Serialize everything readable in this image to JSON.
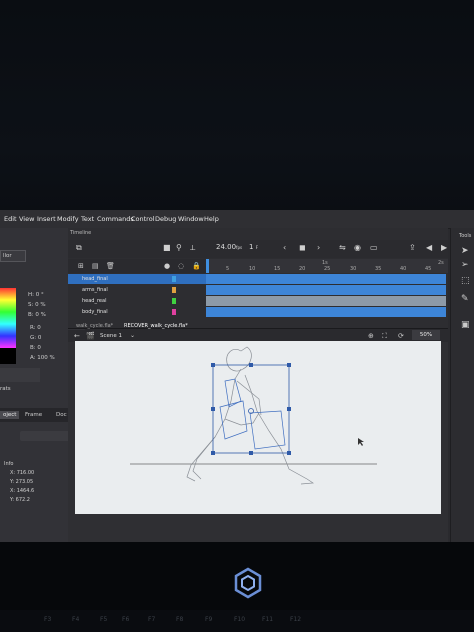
{
  "menu": {
    "items": [
      "Edit",
      "View",
      "Insert",
      "Modify",
      "Text",
      "Commands",
      "Control",
      "Debug",
      "Window",
      "Help"
    ]
  },
  "timeline": {
    "title": "Timeline",
    "fps": "24.00",
    "fps_unit": "fps",
    "frame": "1",
    "frame_unit": "F",
    "ruler_marks": [
      "5",
      "10",
      "15",
      "20",
      "25",
      "30",
      "35",
      "40",
      "45"
    ],
    "ruler_seconds": [
      "1s",
      "2s"
    ],
    "layers": [
      {
        "name": "head_final",
        "color": "#3fa0e0",
        "selected": true
      },
      {
        "name": "arms_final",
        "color": "#e0a040",
        "selected": false
      },
      {
        "name": "head_real",
        "color": "#40d040",
        "selected": false
      },
      {
        "name": "body_final",
        "color": "#e040a0",
        "selected": false
      }
    ]
  },
  "docs": {
    "tabs": [
      "walk_cycle.fla*",
      "RECOVER_walk_cycle.fla*"
    ],
    "scene": "Scene 1",
    "zoom": "50%"
  },
  "left_panel": {
    "dropdown": "llor",
    "hsb": [
      "H: 0 °",
      "S: 0 %",
      "B: 0 %"
    ],
    "rgb": [
      "R: 0",
      "G: 0",
      "B: 0"
    ],
    "alpha": "A: 100 %",
    "tabs": [
      "oject",
      "Frame",
      "Doc"
    ],
    "info_title": "Info",
    "pos": [
      "X: 716.00",
      "Y: 273.05"
    ],
    "cursor": [
      "X: 1464.6",
      "Y: 672.2"
    ],
    "bottom_label": "rats",
    "top_label": "Tools"
  },
  "fkeys": [
    "F3",
    "F4",
    "F5",
    "F6",
    "F7",
    "F8",
    "F9",
    "F10",
    "F11",
    "F12"
  ]
}
